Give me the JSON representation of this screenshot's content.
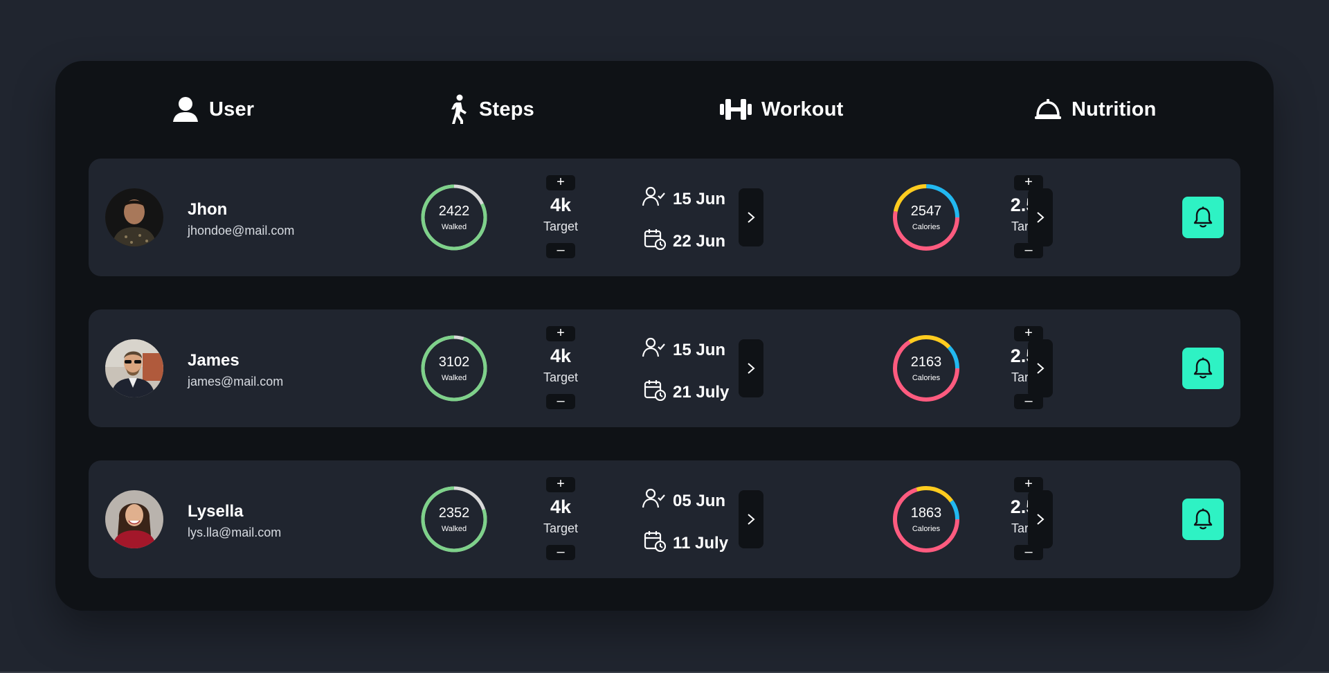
{
  "header": {
    "user_label": "User",
    "steps_label": "Steps",
    "workout_label": "Workout",
    "nutrition_label": "Nutrition"
  },
  "colors": {
    "background": "#20252f",
    "panel": "#0f1216",
    "row": "#20252f",
    "accent": "#2ef2c4",
    "steps_ring": "#7ed18a",
    "ring_track": "#d9d9d9",
    "calorie_red": "#ff5b7f",
    "calorie_yellow": "#ffcc1f",
    "calorie_blue": "#22b8f0"
  },
  "users": [
    {
      "name": "Jhon",
      "email": "jhondoe@mail.com",
      "steps_walked": "2422",
      "steps_walked_label": "Walked",
      "steps_progress": 0.82,
      "steps_target": "4k",
      "steps_target_label": "Target",
      "workout_start": "15 Jun",
      "workout_end": "22 Jun",
      "calories": "2547",
      "calories_label": "Calories",
      "calorie_segments": [
        0.53,
        0.22,
        0.25
      ],
      "calorie_target": "2.5k",
      "calorie_target_label": "Target"
    },
    {
      "name": "James",
      "email": "james@mail.com",
      "steps_walked": "3102",
      "steps_walked_label": "Walked",
      "steps_progress": 0.95,
      "steps_target": "4k",
      "steps_target_label": "Target",
      "workout_start": "15 Jun",
      "workout_end": "21 July",
      "calories": "2163",
      "calories_label": "Calories",
      "calorie_segments": [
        0.66,
        0.22,
        0.12
      ],
      "calorie_target": "2.5k",
      "calorie_target_label": "Target"
    },
    {
      "name": "Lysella",
      "email": "lys.lla@mail.com",
      "steps_walked": "2352",
      "steps_walked_label": "Walked",
      "steps_progress": 0.8,
      "steps_target": "4k",
      "steps_target_label": "Target",
      "workout_start": "05 Jun",
      "workout_end": "11 July",
      "calories": "1863",
      "calories_label": "Calories",
      "calorie_segments": [
        0.7,
        0.2,
        0.1
      ],
      "calorie_target": "2.5k",
      "calorie_target_label": "Target"
    }
  ],
  "icons": {
    "user": "user-icon",
    "steps": "walking-icon",
    "workout": "dumbbell-icon",
    "nutrition": "cloche-icon",
    "workout_start": "user-check-icon",
    "workout_end": "calendar-clock-icon",
    "next": "chevron-right-icon",
    "notify": "bell-icon",
    "increment": "plus-icon",
    "decrement": "minus-icon"
  }
}
